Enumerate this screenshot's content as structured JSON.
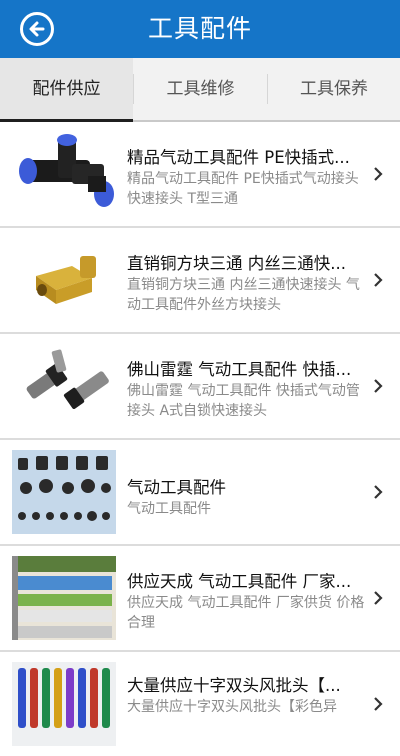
{
  "header": {
    "title": "工具配件",
    "back_icon": "back-arrow-icon"
  },
  "tabs": [
    {
      "label": "配件供应",
      "active": true
    },
    {
      "label": "工具维修",
      "active": false
    },
    {
      "label": "工具保养",
      "active": false
    }
  ],
  "items": [
    {
      "title": "精品气动工具配件 PE快插式...",
      "desc": "精品气动工具配件 PE快插式气动接头 快速接头 T型三通"
    },
    {
      "title": "直销铜方块三通 内丝三通快...",
      "desc": "直销铜方块三通 内丝三通快速接头 气动工具配件外丝方块接头"
    },
    {
      "title": "佛山雷霆 气动工具配件 快插...",
      "desc": "佛山雷霆 气动工具配件 快插式气动管接头 A式自锁快速接头"
    },
    {
      "title": "气动工具配件",
      "desc": "气动工具配件"
    },
    {
      "title": "供应天成 气动工具配件 厂家...",
      "desc": "供应天成 气动工具配件 厂家供货 价格合理"
    },
    {
      "title": "大量供应十字双头风批头【...",
      "desc": "大量供应十字双头风批头【彩色异"
    }
  ],
  "colors": {
    "header": "#1575c8",
    "tab_bg": "#f2f2f2"
  }
}
